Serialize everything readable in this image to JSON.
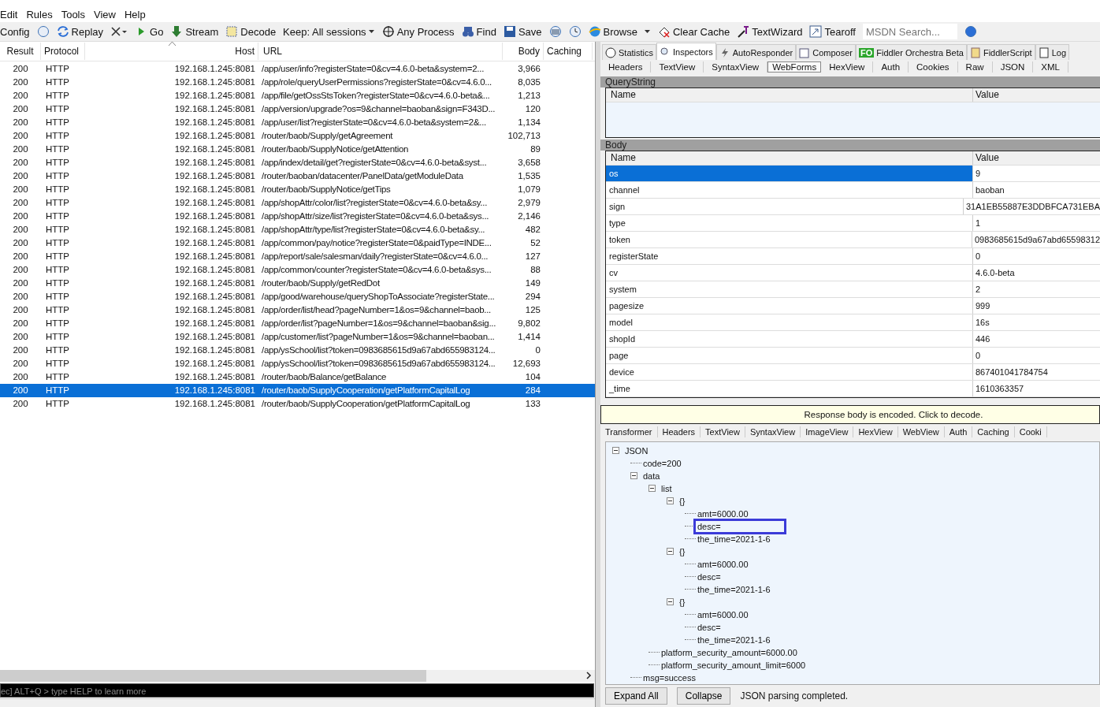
{
  "menu": [
    "Edit",
    "Rules",
    "Tools",
    "View",
    "Help"
  ],
  "toolbar": [
    {
      "kind": "text",
      "label": "Config"
    },
    {
      "kind": "icon"
    },
    {
      "kind": "button",
      "label": "Replay"
    },
    {
      "kind": "dropdown-icon"
    },
    {
      "kind": "button",
      "label": "Go"
    },
    {
      "kind": "button",
      "label": "Stream"
    },
    {
      "kind": "button",
      "label": "Decode"
    },
    {
      "kind": "dropdown",
      "label": "Keep: All sessions"
    },
    {
      "kind": "button",
      "label": "Any Process"
    },
    {
      "kind": "button",
      "label": "Find"
    },
    {
      "kind": "button",
      "label": "Save"
    },
    {
      "kind": "icon"
    },
    {
      "kind": "icon"
    },
    {
      "kind": "button",
      "label": "Browse"
    },
    {
      "kind": "caret"
    },
    {
      "kind": "button",
      "label": "Clear Cache"
    },
    {
      "kind": "button",
      "label": "TextWizard"
    },
    {
      "kind": "button",
      "label": "Tearoff"
    },
    {
      "kind": "search",
      "placeholder": "MSDN Search..."
    },
    {
      "kind": "icon"
    }
  ],
  "sessions": {
    "columns": [
      "Result",
      "Protocol",
      "Host",
      "URL",
      "Body",
      "Caching"
    ],
    "rows": [
      {
        "result": "200",
        "protocol": "HTTP",
        "host": "192.168.1.245:8081",
        "url": "/app/user/info?registerState=0&cv=4.6.0-beta&system=2...",
        "body": "3,966",
        "selected": false
      },
      {
        "result": "200",
        "protocol": "HTTP",
        "host": "192.168.1.245:8081",
        "url": "/app/role/queryUserPermissions?registerState=0&cv=4.6.0...",
        "body": "8,035",
        "selected": false
      },
      {
        "result": "200",
        "protocol": "HTTP",
        "host": "192.168.1.245:8081",
        "url": "/app/file/getOssStsToken?registerState=0&cv=4.6.0-beta&...",
        "body": "1,213",
        "selected": false
      },
      {
        "result": "200",
        "protocol": "HTTP",
        "host": "192.168.1.245:8081",
        "url": "/app/version/upgrade?os=9&channel=baoban&sign=F343D...",
        "body": "120",
        "selected": false
      },
      {
        "result": "200",
        "protocol": "HTTP",
        "host": "192.168.1.245:8081",
        "url": "/app/user/list?registerState=0&cv=4.6.0-beta&system=2&...",
        "body": "1,134",
        "selected": false
      },
      {
        "result": "200",
        "protocol": "HTTP",
        "host": "192.168.1.245:8081",
        "url": "/router/baob/Supply/getAgreement",
        "body": "102,713",
        "selected": false
      },
      {
        "result": "200",
        "protocol": "HTTP",
        "host": "192.168.1.245:8081",
        "url": "/router/baob/SupplyNotice/getAttention",
        "body": "89",
        "selected": false
      },
      {
        "result": "200",
        "protocol": "HTTP",
        "host": "192.168.1.245:8081",
        "url": "/app/index/detail/get?registerState=0&cv=4.6.0-beta&syst...",
        "body": "3,658",
        "selected": false
      },
      {
        "result": "200",
        "protocol": "HTTP",
        "host": "192.168.1.245:8081",
        "url": "/router/baoban/datacenter/PanelData/getModuleData",
        "body": "1,535",
        "selected": false
      },
      {
        "result": "200",
        "protocol": "HTTP",
        "host": "192.168.1.245:8081",
        "url": "/router/baob/SupplyNotice/getTips",
        "body": "1,079",
        "selected": false
      },
      {
        "result": "200",
        "protocol": "HTTP",
        "host": "192.168.1.245:8081",
        "url": "/app/shopAttr/color/list?registerState=0&cv=4.6.0-beta&sy...",
        "body": "2,979",
        "selected": false
      },
      {
        "result": "200",
        "protocol": "HTTP",
        "host": "192.168.1.245:8081",
        "url": "/app/shopAttr/size/list?registerState=0&cv=4.6.0-beta&sys...",
        "body": "2,146",
        "selected": false
      },
      {
        "result": "200",
        "protocol": "HTTP",
        "host": "192.168.1.245:8081",
        "url": "/app/shopAttr/type/list?registerState=0&cv=4.6.0-beta&sy...",
        "body": "482",
        "selected": false
      },
      {
        "result": "200",
        "protocol": "HTTP",
        "host": "192.168.1.245:8081",
        "url": "/app/common/pay/notice?registerState=0&paidType=INDE...",
        "body": "52",
        "selected": false
      },
      {
        "result": "200",
        "protocol": "HTTP",
        "host": "192.168.1.245:8081",
        "url": "/app/report/sale/salesman/daily?registerState=0&cv=4.6.0...",
        "body": "127",
        "selected": false
      },
      {
        "result": "200",
        "protocol": "HTTP",
        "host": "192.168.1.245:8081",
        "url": "/app/common/counter?registerState=0&cv=4.6.0-beta&sys...",
        "body": "88",
        "selected": false
      },
      {
        "result": "200",
        "protocol": "HTTP",
        "host": "192.168.1.245:8081",
        "url": "/router/baob/Supply/getRedDot",
        "body": "149",
        "selected": false
      },
      {
        "result": "200",
        "protocol": "HTTP",
        "host": "192.168.1.245:8081",
        "url": "/app/good/warehouse/queryShopToAssociate?registerState...",
        "body": "294",
        "selected": false
      },
      {
        "result": "200",
        "protocol": "HTTP",
        "host": "192.168.1.245:8081",
        "url": "/app/order/list/head?pageNumber=1&os=9&channel=baob...",
        "body": "125",
        "selected": false
      },
      {
        "result": "200",
        "protocol": "HTTP",
        "host": "192.168.1.245:8081",
        "url": "/app/order/list?pageNumber=1&os=9&channel=baoban&sig...",
        "body": "9,802",
        "selected": false
      },
      {
        "result": "200",
        "protocol": "HTTP",
        "host": "192.168.1.245:8081",
        "url": "/app/customer/list?pageNumber=1&os=9&channel=baoban...",
        "body": "1,414",
        "selected": false
      },
      {
        "result": "200",
        "protocol": "HTTP",
        "host": "192.168.1.245:8081",
        "url": "/app/ysSchool/list?token=0983685615d9a67abd655983124...",
        "body": "0",
        "selected": false
      },
      {
        "result": "200",
        "protocol": "HTTP",
        "host": "192.168.1.245:8081",
        "url": "/app/ysSchool/list?token=0983685615d9a67abd655983124...",
        "body": "12,693",
        "selected": false
      },
      {
        "result": "200",
        "protocol": "HTTP",
        "host": "192.168.1.245:8081",
        "url": "/router/baob/Balance/getBalance",
        "body": "104",
        "selected": false
      },
      {
        "result": "200",
        "protocol": "HTTP",
        "host": "192.168.1.245:8081",
        "url": "/router/baob/SupplyCooperation/getPlatformCapitalLog",
        "body": "284",
        "selected": true
      },
      {
        "result": "200",
        "protocol": "HTTP",
        "host": "192.168.1.245:8081",
        "url": "/router/baob/SupplyCooperation/getPlatformCapitalLog",
        "body": "133",
        "selected": false
      }
    ]
  },
  "quickexec": {
    "placeholder": "ec] ALT+Q > type HELP to learn more"
  },
  "main_tabs": [
    {
      "label": "Statistics",
      "selected": false
    },
    {
      "label": "Inspectors",
      "selected": true
    },
    {
      "label": "AutoResponder",
      "selected": false
    },
    {
      "label": "Composer",
      "selected": false
    },
    {
      "label": "Fiddler Orchestra Beta",
      "badge": "FO",
      "selected": false
    },
    {
      "label": "FiddlerScript",
      "selected": false
    },
    {
      "label": "Log",
      "selected": false
    }
  ],
  "request_tabs": [
    {
      "label": "Headers",
      "selected": false
    },
    {
      "label": "TextView",
      "selected": false
    },
    {
      "label": "SyntaxView",
      "selected": false
    },
    {
      "label": "WebForms",
      "selected": true
    },
    {
      "label": "HexView",
      "selected": false
    },
    {
      "label": "Auth",
      "selected": false
    },
    {
      "label": "Cookies",
      "selected": false
    },
    {
      "label": "Raw",
      "selected": false
    },
    {
      "label": "JSON",
      "selected": false
    },
    {
      "label": "XML",
      "selected": false
    }
  ],
  "querystring": {
    "title": "QueryString",
    "columns": [
      "Name",
      "Value"
    ]
  },
  "body": {
    "title": "Body",
    "columns": [
      "Name",
      "Value"
    ],
    "rows": [
      {
        "name": "os",
        "value": "9",
        "selected": true
      },
      {
        "name": "channel",
        "value": "baoban",
        "selected": false
      },
      {
        "name": "sign",
        "value": "31A1EB55887E3DDBFCA731EBA",
        "selected": false
      },
      {
        "name": "type",
        "value": "1",
        "selected": false
      },
      {
        "name": "token",
        "value": "0983685615d9a67abd65598312",
        "selected": false
      },
      {
        "name": "registerState",
        "value": "0",
        "selected": false
      },
      {
        "name": "cv",
        "value": "4.6.0-beta",
        "selected": false
      },
      {
        "name": "system",
        "value": "2",
        "selected": false
      },
      {
        "name": "pagesize",
        "value": "999",
        "selected": false
      },
      {
        "name": "model",
        "value": "16s",
        "selected": false
      },
      {
        "name": "shopId",
        "value": "446",
        "selected": false
      },
      {
        "name": "page",
        "value": "0",
        "selected": false
      },
      {
        "name": "device",
        "value": "867401041784754",
        "selected": false
      },
      {
        "name": "_time",
        "value": "1610363357",
        "selected": false
      }
    ]
  },
  "response_notice": "Response body is encoded. Click to decode.",
  "response_tabs": [
    {
      "label": "Transformer",
      "selected": false
    },
    {
      "label": "Headers",
      "selected": false
    },
    {
      "label": "TextView",
      "selected": false
    },
    {
      "label": "SyntaxView",
      "selected": false
    },
    {
      "label": "ImageView",
      "selected": false
    },
    {
      "label": "HexView",
      "selected": false
    },
    {
      "label": "WebView",
      "selected": false
    },
    {
      "label": "Auth",
      "selected": false
    },
    {
      "label": "Caching",
      "selected": false
    },
    {
      "label": "Cooki",
      "selected": false
    }
  ],
  "json_tree": [
    {
      "label": "JSON",
      "expanded": true,
      "selected": false,
      "children": [
        {
          "label": "code=200",
          "selected": false
        },
        {
          "label": "data",
          "expanded": true,
          "selected": false,
          "children": [
            {
              "label": "list",
              "expanded": true,
              "selected": false,
              "children": [
                {
                  "label": "{}",
                  "expanded": true,
                  "selected": false,
                  "children": [
                    {
                      "label": "amt=6000.00",
                      "selected": false
                    },
                    {
                      "label": "desc=",
                      "selected": true
                    },
                    {
                      "label": "the_time=2021-1-6",
                      "selected": false
                    }
                  ]
                },
                {
                  "label": "{}",
                  "expanded": true,
                  "selected": false,
                  "children": [
                    {
                      "label": "amt=6000.00",
                      "selected": false
                    },
                    {
                      "label": "desc=",
                      "selected": false
                    },
                    {
                      "label": "the_time=2021-1-6",
                      "selected": false
                    }
                  ]
                },
                {
                  "label": "{}",
                  "expanded": true,
                  "selected": false,
                  "children": [
                    {
                      "label": "amt=6000.00",
                      "selected": false
                    },
                    {
                      "label": "desc=",
                      "selected": false
                    },
                    {
                      "label": "the_time=2021-1-6",
                      "selected": false
                    }
                  ]
                }
              ]
            },
            {
              "label": "platform_security_amount=6000.00",
              "selected": false
            },
            {
              "label": "platform_security_amount_limit=6000",
              "selected": false
            }
          ]
        },
        {
          "label": "msg=success",
          "selected": false
        }
      ]
    }
  ],
  "tree_buttons": [
    "Expand All",
    "Collapse"
  ],
  "tree_status": "JSON parsing completed."
}
